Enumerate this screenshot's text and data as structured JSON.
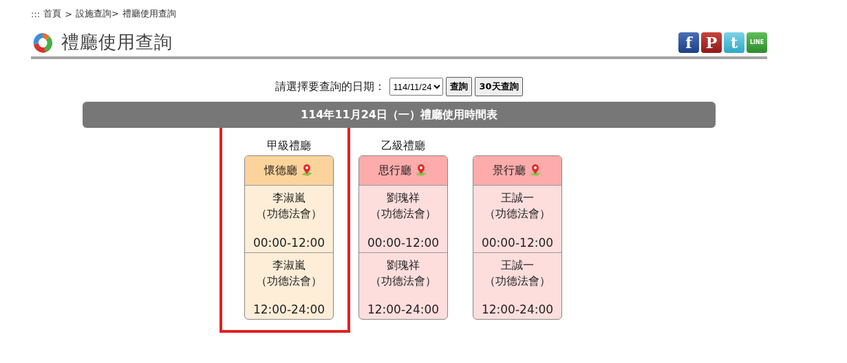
{
  "breadcrumb": [
    {
      "label": ":::"
    },
    {
      "label": "首頁"
    },
    {
      "label": ">"
    },
    {
      "label": "設施查詢>"
    },
    {
      "label": "禮廳使用查詢"
    }
  ],
  "page_title": "禮廳使用查詢",
  "share_buttons": [
    {
      "kind": "facebook",
      "label": "f"
    },
    {
      "kind": "plurk",
      "label": "P"
    },
    {
      "kind": "twitter",
      "label": "t"
    },
    {
      "kind": "line",
      "label": "LINE"
    }
  ],
  "date_picker": {
    "label": "請選擇要查詢的日期：",
    "value": "114/11/24",
    "buttons": [
      "查詢",
      "30天查詢"
    ]
  },
  "schedule_title": "114年11月24日（一）禮廳使用時間表",
  "groups": [
    {
      "name": "甲級禮廳",
      "color": "#fdd39c",
      "halls": [
        {
          "name": "懷德廳",
          "slots": [
            {
              "person": "李淑嵐",
              "event": "（功德法會）",
              "time": "00:00-12:00"
            },
            {
              "person": "李淑嵐",
              "event": "（功德法會）",
              "time": "12:00-24:00"
            }
          ]
        }
      ]
    },
    {
      "name": "乙級禮廳",
      "color": "#fdabab",
      "halls": [
        {
          "name": "思行廳",
          "slots": [
            {
              "person": "劉瑰祥",
              "event": "（功德法會）",
              "time": "00:00-12:00"
            },
            {
              "person": "劉瑰祥",
              "event": "（功德法會）",
              "time": "12:00-24:00"
            }
          ]
        },
        {
          "name": "景行廳",
          "slots": [
            {
              "person": "王誠一",
              "event": "（功德法會）",
              "time": "00:00-12:00"
            },
            {
              "person": "王誠一",
              "event": "（功德法會）",
              "time": "12:00-24:00"
            }
          ]
        }
      ]
    }
  ]
}
